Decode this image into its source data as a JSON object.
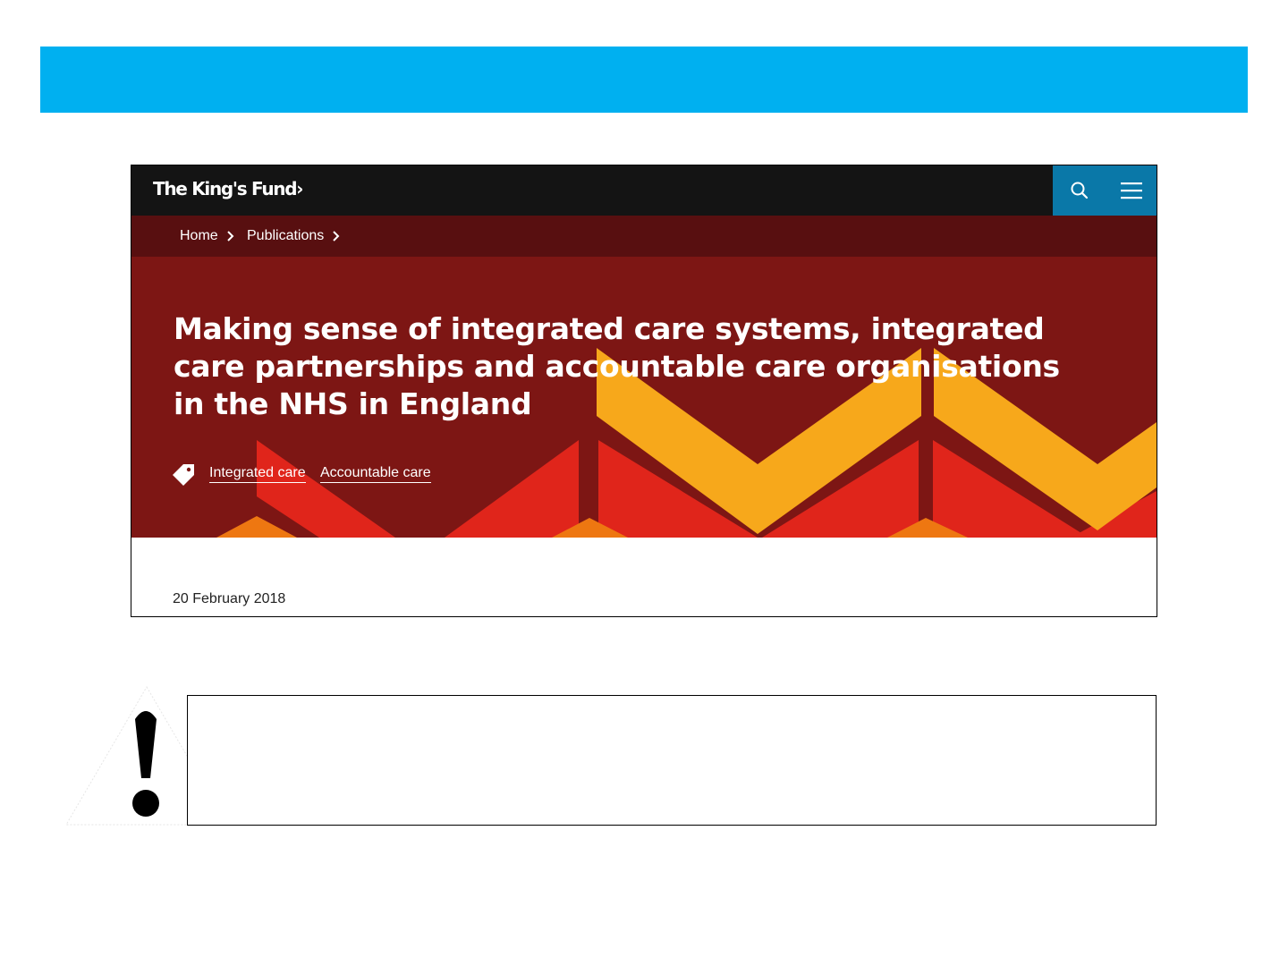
{
  "site": {
    "logo_text": "The King's Fund",
    "logo_chevron": "›",
    "search_icon": "search-icon",
    "menu_icon": "hamburger-menu-icon",
    "colors": {
      "top_bar": "#00b0f0",
      "header": "#141414",
      "header_actions": "#0a78a8",
      "breadcrumb": "#580f10",
      "hero": "#7d1614"
    }
  },
  "breadcrumb": [
    {
      "label": "Home"
    },
    {
      "label": "Publications"
    }
  ],
  "hero": {
    "title": "Making sense of integrated care systems, integrated care partnerships and accountable care organisations in the NHS in England",
    "tag_icon": "tag-icon",
    "tags": [
      {
        "label": "Integrated care"
      },
      {
        "label": "Accountable care"
      }
    ]
  },
  "article": {
    "date": "20 February 2018"
  },
  "notice": {
    "icon": "warning-exclamation-icon"
  }
}
